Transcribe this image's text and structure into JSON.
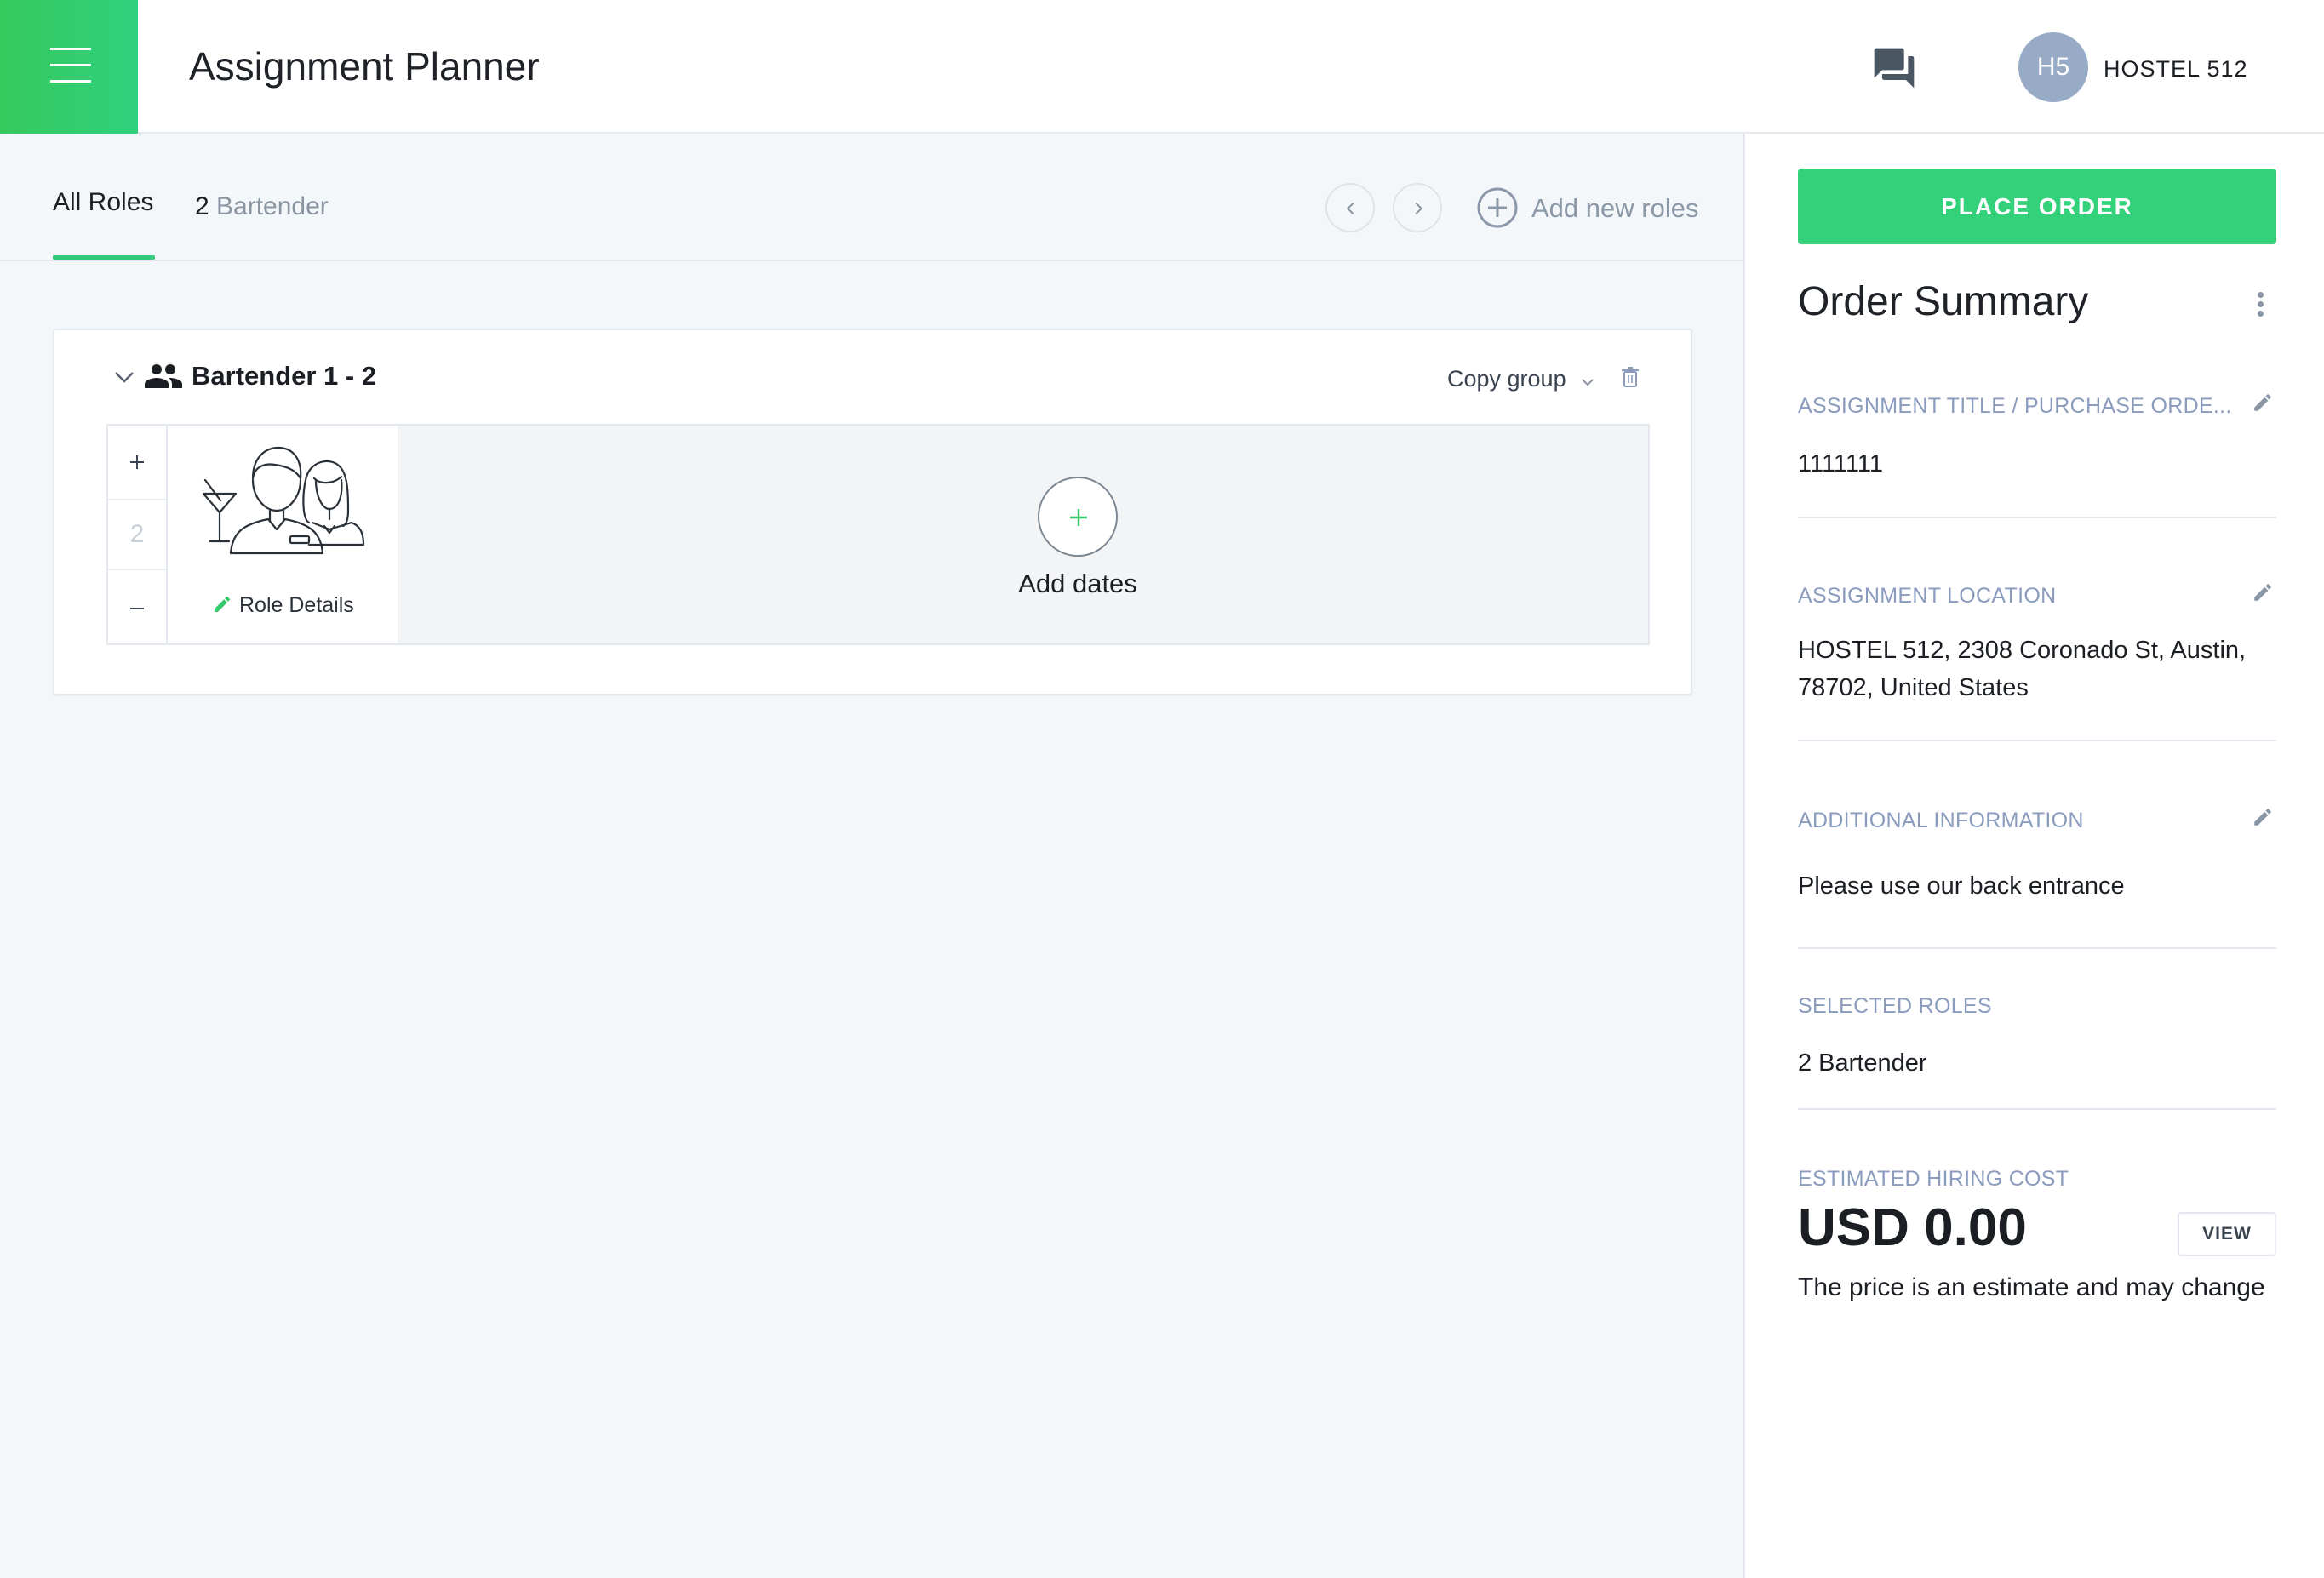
{
  "header": {
    "title": "Assignment Planner",
    "avatar_initials": "H5",
    "account_name": "HOSTEL 512",
    "menu_icon": "hamburger-icon",
    "chat_icon": "chat-icon"
  },
  "tabs": {
    "all_roles": "All Roles",
    "role_count": "2",
    "role_label": "Bartender",
    "add_new_roles": "Add new roles"
  },
  "group": {
    "title": "Bartender 1 - 2",
    "copy_group": "Copy group",
    "quantity": "2",
    "role_details": "Role Details",
    "add_dates": "Add dates"
  },
  "summary": {
    "place_order": "PLACE ORDER",
    "title": "Order Summary",
    "assignment_title_label": "ASSIGNMENT TITLE / PURCHASE ORDE...",
    "assignment_title_value": "1111111",
    "location_label": "ASSIGNMENT LOCATION",
    "location_value": "HOSTEL 512, 2308 Coronado St, Austin, 78702, United States",
    "additional_label": "ADDITIONAL INFORMATION",
    "additional_value": "Please use our back entrance",
    "roles_label": "SELECTED ROLES",
    "roles_value": "2 Bartender",
    "cost_label": "ESTIMATED HIRING COST",
    "cost_value": "USD 0.00",
    "view": "VIEW",
    "cost_note": "The price is an estimate and may change"
  },
  "colors": {
    "accent_green": "#33d17a",
    "label_blue_gray": "#8a9bbe",
    "avatar_bg": "#97abc6"
  }
}
